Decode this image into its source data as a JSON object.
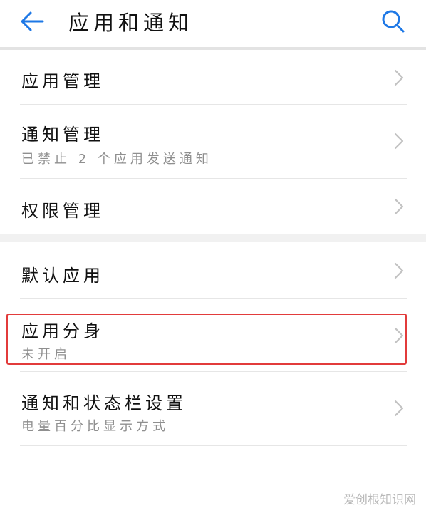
{
  "header": {
    "title": "应用和通知",
    "back_icon": "arrow-left-icon",
    "search_icon": "search-icon",
    "accent_color": "#1e78e6"
  },
  "group1": {
    "items": [
      {
        "label": "应用管理",
        "subtitle": ""
      },
      {
        "label": "通知管理",
        "subtitle": "已禁止 2 个应用发送通知"
      },
      {
        "label": "权限管理",
        "subtitle": ""
      }
    ]
  },
  "group2": {
    "items": [
      {
        "label": "默认应用",
        "subtitle": ""
      },
      {
        "label": "应用分身",
        "subtitle": "未开启"
      },
      {
        "label": "通知和状态栏设置",
        "subtitle": "电量百分比显示方式"
      }
    ]
  },
  "annotation": {
    "highlight_color": "#e23b3b"
  },
  "watermark": {
    "text": "爱创根知识网"
  }
}
